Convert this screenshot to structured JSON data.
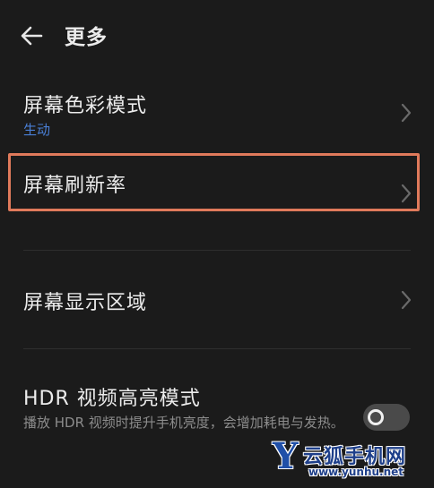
{
  "header": {
    "title": "更多",
    "back_icon": "arrow-left-icon"
  },
  "items": [
    {
      "title": "屏幕色彩模式",
      "subtitle": "生动",
      "icon": "chevron-right-icon"
    },
    {
      "title": "屏幕刷新率",
      "icon": "chevron-right-icon",
      "highlighted": true
    },
    {
      "title": "屏幕显示区域",
      "icon": "chevron-right-icon"
    }
  ],
  "hdr": {
    "title": "HDR 视频高亮模式",
    "description": "播放 HDR 视频时提升手机亮度，会增加耗电与发热。",
    "enabled": false
  },
  "watermark": {
    "letter": "Y",
    "name": "云狐手机网",
    "url": "www.yunhu.net"
  },
  "colors": {
    "background": "#1b1b1b",
    "accent_subtitle": "#4a7fd6",
    "highlight_border": "#e07a5b",
    "divider": "#2e2e2e"
  }
}
